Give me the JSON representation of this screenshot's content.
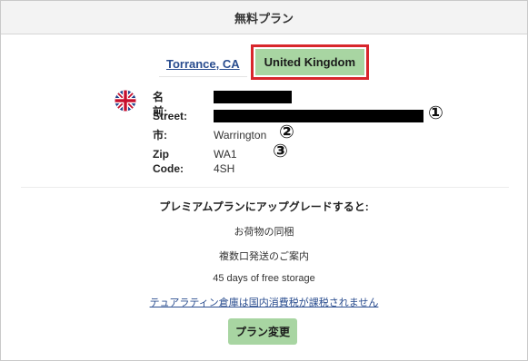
{
  "header": {
    "title": "無料プラン"
  },
  "tabs": {
    "link_label": "Torrance, CA",
    "active_label": "United Kingdom"
  },
  "address": {
    "flag_icon": "uk-flag-icon",
    "name_label": "名前:",
    "street_label": "Street:",
    "city_label": "市:",
    "city_value": "Warrington",
    "zip_label": "Zip Code:",
    "zip_value": "WA1 4SH",
    "markers": [
      "①",
      "②",
      "③"
    ]
  },
  "premium": {
    "title": "プレミアムプランにアップグレードすると:",
    "items": [
      "お荷物の同梱",
      "複数口発送のご案内",
      "45 days of free storage"
    ],
    "link_text": "テュアラティン倉庫は国内消費税が課税されません"
  },
  "button": {
    "change_label": "プラン変更"
  },
  "colors": {
    "accent_green": "#a8d5a2",
    "highlight_red": "#d8262c",
    "link_blue": "#2a4d8f"
  }
}
